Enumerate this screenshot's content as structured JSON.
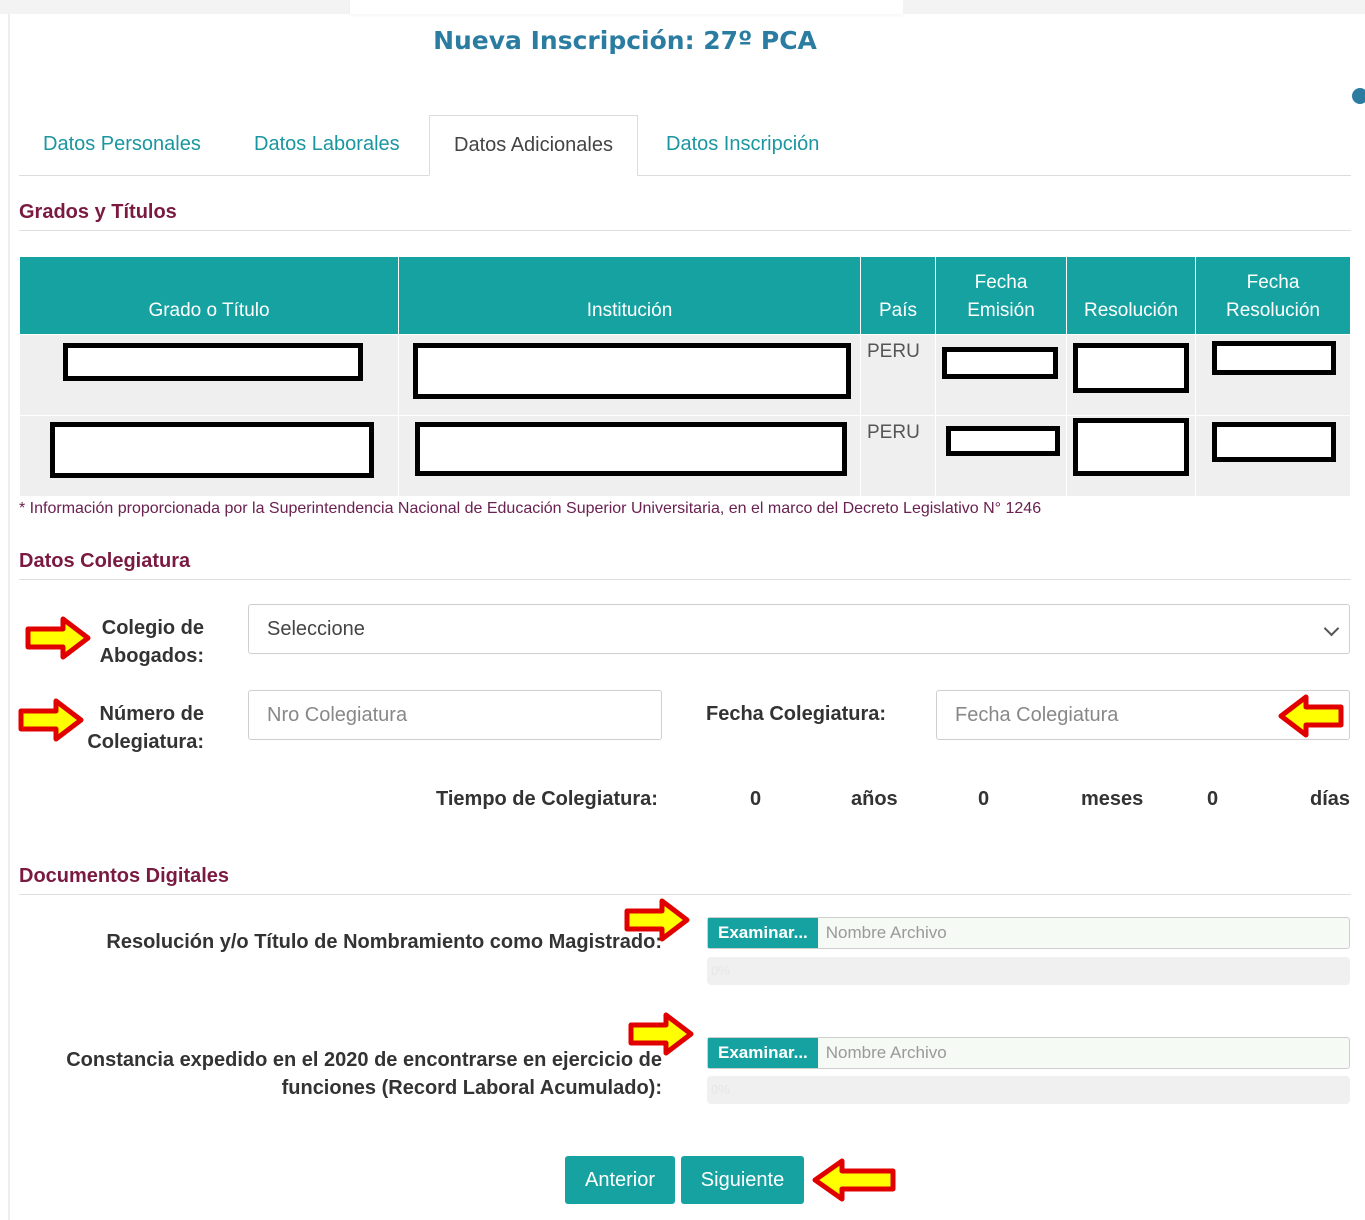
{
  "page": {
    "title": "Nueva Inscripción: 27º PCA"
  },
  "tabs": [
    {
      "label": "Datos Personales",
      "active": false
    },
    {
      "label": "Datos Laborales",
      "active": false
    },
    {
      "label": "Datos Adicionales",
      "active": true
    },
    {
      "label": "Datos Inscripción",
      "active": false
    }
  ],
  "grados": {
    "section_title": "Grados y Títulos",
    "columns": [
      "Grado o Título",
      "Institución",
      "País",
      "Fecha Emisión",
      "Resolución",
      "Fecha Resolución"
    ],
    "col_fecha": "Fecha",
    "col_emision": "Emisión",
    "col_resolucion": "Resolución",
    "rows": [
      {
        "pais": "PERU"
      },
      {
        "pais": "PERU"
      }
    ],
    "note": "* Información proporcionada por la Superintendencia Nacional de Educación Superior Universitaria, en el marco del Decreto Legislativo N° 1246"
  },
  "colegiatura": {
    "section_title": "Datos Colegiatura",
    "colegio_label_1": "Colegio de",
    "colegio_label_2": "Abogados:",
    "colegio_value": "Seleccione",
    "numero_label_1": "Número de",
    "numero_label_2": "Colegiatura:",
    "numero_placeholder": "Nro Colegiatura",
    "fecha_label": "Fecha Colegiatura:",
    "fecha_placeholder": "Fecha Colegiatura",
    "tiempo_label": "Tiempo de Colegiatura:",
    "anios_value": "0",
    "anios_unit": "años",
    "meses_value": "0",
    "meses_unit": "meses",
    "dias_value": "0",
    "dias_unit": "días"
  },
  "documentos": {
    "section_title": "Documentos Digitales",
    "doc1_label": "Resolución y/o Título de Nombramiento como Magistrado:",
    "doc2_label_1": "Constancia expedido en el 2020 de encontrarse en ejercicio de",
    "doc2_label_2": "funciones (Record Laboral Acumulado):",
    "browse_label": "Examinar...",
    "file_placeholder": "Nombre Archivo",
    "progress_text": "0%"
  },
  "nav": {
    "prev_label": "Anterior",
    "next_label": "Siguiente"
  },
  "colors": {
    "accent": "#17a2a2",
    "title": "#2a7ca0",
    "section": "#7a1a40",
    "arrow_fill": "#ffff00",
    "arrow_stroke": "#e00000"
  }
}
